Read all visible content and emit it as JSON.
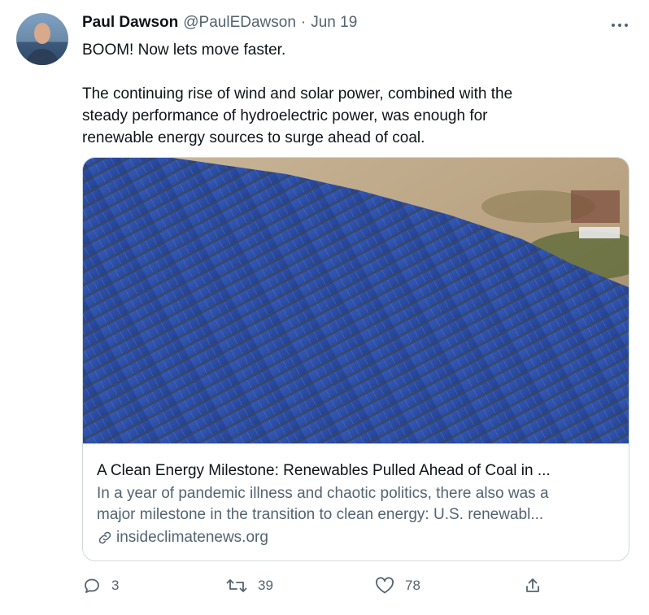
{
  "author": {
    "name": "Paul Dawson",
    "handle": "@PaulEDawson",
    "separator": "·",
    "date": "Jun 19"
  },
  "tweet": {
    "line1": "BOOM! Now lets move faster.",
    "paragraph": [
      "The continuing rise of wind and solar power, combined with the",
      "steady performance of hydroelectric power, was enough for",
      "renewable energy sources to surge ahead of coal."
    ]
  },
  "card": {
    "title": "A Clean Energy Milestone: Renewables Pulled Ahead of Coal in ...",
    "description": [
      "In a year of pandemic illness and chaotic politics, there also was a",
      "major milestone in the transition to clean energy: U.S. renewabl..."
    ],
    "domain": "insideclimatenews.org",
    "image_alt": "Aerial view of a large solar panel farm"
  },
  "actions": {
    "replies": "3",
    "retweets": "39",
    "likes": "78"
  },
  "colors": {
    "text_primary": "#0f1419",
    "text_secondary": "#536471",
    "border": "#cfd9de",
    "panel_blue": "#2f4fa8"
  },
  "icons": {
    "more": "more-horizontal-icon",
    "reply": "reply-icon",
    "retweet": "retweet-icon",
    "like": "heart-icon",
    "share": "share-icon",
    "link": "link-icon"
  }
}
